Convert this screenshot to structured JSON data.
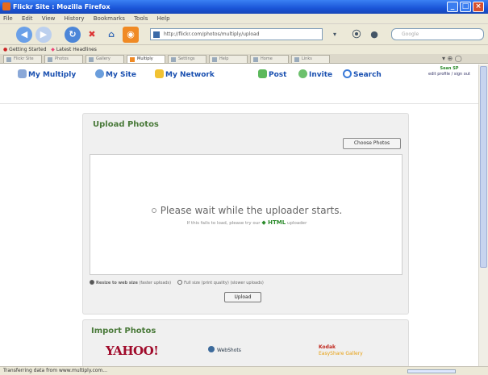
{
  "window": {
    "title": "Flickr Site : Mozilla Firefox",
    "minimize": "_",
    "maximize": "□",
    "close": "×"
  },
  "menu": [
    "File",
    "Edit",
    "View",
    "History",
    "Bookmarks",
    "Tools",
    "Help"
  ],
  "nav": {
    "url": "http://flickr.com/photos/multiply/upload",
    "search_placeholder": "Google"
  },
  "bookmarks": [
    "Getting Started",
    "Latest Headlines"
  ],
  "tabs": [
    "Flickr Site",
    "Photos",
    "Gallery",
    "Multiply",
    "Settings",
    "Help",
    "Home",
    "Links"
  ],
  "site_nav": {
    "my_multiply": "My Multiply",
    "my_site": "My Site",
    "my_network": "My Network",
    "post": "Post",
    "invite": "Invite",
    "search": "Search",
    "user_name": "Sean SP",
    "user_link": "edit profile / sign out"
  },
  "upload": {
    "heading": "Upload Photos",
    "choose_button": "Choose Photos",
    "wait_message": "Please wait while the uploader starts.",
    "fallback_prefix": "If this fails to load, please try our",
    "fallback_link": "HTML",
    "fallback_suffix": "uploader",
    "resize_option": "Resize to web size",
    "resize_note": "(faster uploads)",
    "full_option": "Full size (print quality)",
    "full_note": "(slower uploads)",
    "upload_button": "Upload"
  },
  "import": {
    "heading": "Import Photos",
    "yahoo": "YAHOO!",
    "webshots": "WebShots",
    "kodak": "Kodak",
    "kodak_sub": "EasyShare Gallery"
  },
  "status": "Transferring data from www.multiply.com..."
}
